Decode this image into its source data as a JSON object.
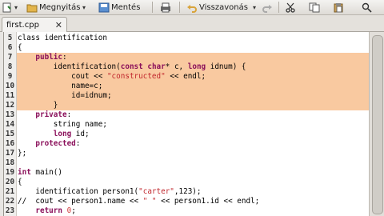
{
  "toolbar": {
    "open_label": "Megnyitás",
    "save_label": "Mentés",
    "undo_label": "Visszavonás"
  },
  "tab": {
    "label": "first.cpp",
    "close": "✕"
  },
  "editor": {
    "highlight_lines": [
      7,
      12
    ],
    "lines": [
      {
        "n": "5",
        "segs": [
          {
            "t": "class identification",
            "c": ""
          }
        ]
      },
      {
        "n": "6",
        "segs": [
          {
            "t": "{",
            "c": ""
          }
        ]
      },
      {
        "n": "7",
        "segs": [
          {
            "t": "    ",
            "c": ""
          },
          {
            "t": "public",
            "c": "kw"
          },
          {
            "t": ":",
            "c": ""
          }
        ]
      },
      {
        "n": "8",
        "segs": [
          {
            "t": "        identification(",
            "c": ""
          },
          {
            "t": "const",
            "c": "kw"
          },
          {
            "t": " ",
            "c": ""
          },
          {
            "t": "char",
            "c": "kw"
          },
          {
            "t": "* c, ",
            "c": ""
          },
          {
            "t": "long",
            "c": "kw"
          },
          {
            "t": " idnum) {",
            "c": ""
          }
        ]
      },
      {
        "n": "9",
        "segs": [
          {
            "t": "            cout << ",
            "c": ""
          },
          {
            "t": "\"constructed\"",
            "c": "str"
          },
          {
            "t": " << endl;",
            "c": ""
          }
        ]
      },
      {
        "n": "10",
        "segs": [
          {
            "t": "            name=c;",
            "c": ""
          }
        ]
      },
      {
        "n": "11",
        "segs": [
          {
            "t": "            id=idnum;",
            "c": ""
          }
        ]
      },
      {
        "n": "12",
        "segs": [
          {
            "t": "        }",
            "c": ""
          }
        ]
      },
      {
        "n": "13",
        "segs": [
          {
            "t": "    ",
            "c": ""
          },
          {
            "t": "private",
            "c": "kw"
          },
          {
            "t": ":",
            "c": ""
          }
        ]
      },
      {
        "n": "14",
        "segs": [
          {
            "t": "        string name;",
            "c": ""
          }
        ]
      },
      {
        "n": "15",
        "segs": [
          {
            "t": "        ",
            "c": ""
          },
          {
            "t": "long",
            "c": "kw"
          },
          {
            "t": " id;",
            "c": ""
          }
        ]
      },
      {
        "n": "16",
        "segs": [
          {
            "t": "    ",
            "c": ""
          },
          {
            "t": "protected",
            "c": "kw"
          },
          {
            "t": ":",
            "c": ""
          }
        ]
      },
      {
        "n": "17",
        "segs": [
          {
            "t": "};",
            "c": ""
          }
        ]
      },
      {
        "n": "18",
        "segs": [
          {
            "t": "",
            "c": ""
          }
        ]
      },
      {
        "n": "19",
        "segs": [
          {
            "t": "int",
            "c": "kw"
          },
          {
            "t": " main()",
            "c": ""
          }
        ]
      },
      {
        "n": "20",
        "segs": [
          {
            "t": "{",
            "c": ""
          }
        ]
      },
      {
        "n": "21",
        "segs": [
          {
            "t": "    identification person1(",
            "c": ""
          },
          {
            "t": "\"carter\"",
            "c": "str"
          },
          {
            "t": ",123);",
            "c": ""
          }
        ]
      },
      {
        "n": "22",
        "segs": [
          {
            "t": "//  cout << person1.name << ",
            "c": ""
          },
          {
            "t": "\" \"",
            "c": "str"
          },
          {
            "t": " << person1.id << endl;",
            "c": ""
          }
        ]
      },
      {
        "n": "23",
        "segs": [
          {
            "t": "    ",
            "c": ""
          },
          {
            "t": "return",
            "c": "kw"
          },
          {
            "t": " ",
            "c": ""
          },
          {
            "t": "0",
            "c": "num"
          },
          {
            "t": ";",
            "c": ""
          }
        ]
      }
    ]
  },
  "colors": {
    "highlight": "#f9c9a0",
    "keyword": "#8a0f5a",
    "string": "#c1272d"
  }
}
